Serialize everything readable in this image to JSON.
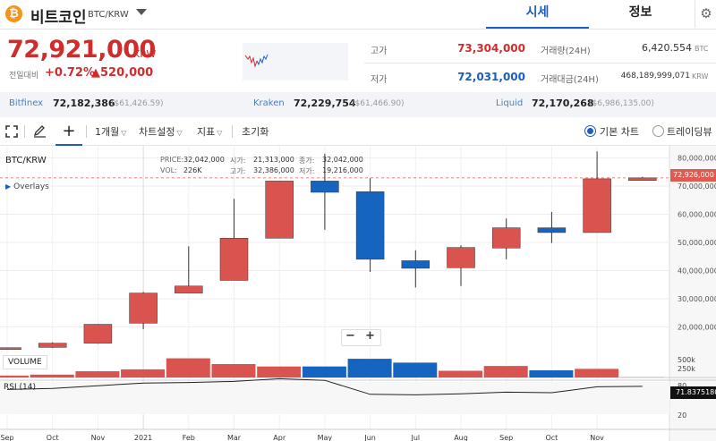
{
  "header": {
    "coin_icon_glyph": "₿",
    "coin_name": "비트코인",
    "coin_pair": "BTC/KRW",
    "tabs": [
      {
        "label": "시세",
        "active": true
      },
      {
        "label": "정보",
        "active": false
      }
    ],
    "gear_icon": "gear-icon"
  },
  "price": {
    "current": "72,921,000",
    "unit": "KRW",
    "change_label": "전일대비",
    "change_pct": "+0.72%",
    "change_amt": "▲520,000",
    "up_color": "#d12c2c",
    "down_color": "#1d5dbf"
  },
  "stats": {
    "high_label": "고가",
    "high_value": "73,304,000",
    "low_label": "저가",
    "low_value": "72,031,000",
    "volume_label": "거래량(24H)",
    "volume_value": "6,420.554",
    "volume_unit": "BTC",
    "amount_label": "거래대금(24H)",
    "amount_value": "468,189,999,071",
    "amount_unit": "KRW"
  },
  "exchanges": [
    {
      "name": "Bitfinex",
      "price": "72,182,386",
      "usd": "($61,426.59)"
    },
    {
      "name": "Kraken",
      "price": "72,229,754",
      "usd": "($61,466.90)"
    },
    {
      "name": "Liquid",
      "price": "72,170,268",
      "usd": "($6,986,135.00)"
    }
  ],
  "toolbar": {
    "fullscreen_icon": "fullscreen-icon",
    "draw_icon": "pencil-icon",
    "crosshair_icon": "crosshair-icon",
    "plus_glyph": "+",
    "interval": "1개월",
    "chart_settings": "차트설정",
    "indicators": "지표",
    "reset": "초기화",
    "basic_chart": "기본 차트",
    "trading_view": "트레이딩뷰"
  },
  "chart": {
    "symbol": "BTC/KRW",
    "overlays": "Overlays",
    "ohlc": {
      "price_label": "PRICE:",
      "price": "32,042,000",
      "open_label": "시가:",
      "open": "21,313,000",
      "close_label": "종가:",
      "close": "32,042,000",
      "vol_label": "VOL:",
      "vol": "226K",
      "high_label": "고가:",
      "high": "32,386,000",
      "low_label": "저가:",
      "low": "19,216,000"
    },
    "zoom_minus": "−",
    "zoom_plus": "+",
    "volume_label": "VOLUME",
    "rsi_label": "RSI (14)",
    "last_price_tag": "72,926,000",
    "rsi_value_tag": "71.83751808",
    "volume_ticks": [
      "500k",
      "250k"
    ],
    "rsi_ticks": [
      "80",
      "20"
    ]
  },
  "chart_data": {
    "type": "candlestick",
    "y_ticks": [
      80000000,
      70000000,
      60000000,
      50000000,
      40000000,
      30000000,
      20000000
    ],
    "y_tick_labels": [
      "80,000,000",
      "70,000,000",
      "60,000,000",
      "50,000,000",
      "40,000,000",
      "30,000,000",
      "20,000,000"
    ],
    "ylim": [
      9000000,
      84000000
    ],
    "x_labels": [
      "Sep",
      "Oct",
      "Nov",
      "2021",
      "Feb",
      "Mar",
      "Apr",
      "May",
      "Jun",
      "Jul",
      "Aug",
      "Sep",
      "Oct",
      "Nov"
    ],
    "candles": [
      {
        "o": 12000000,
        "h": 12500000,
        "l": 11600000,
        "c": 12600000,
        "v": 40000,
        "rsi": 66
      },
      {
        "o": 12700000,
        "h": 14500000,
        "l": 12500000,
        "c": 14200000,
        "v": 60000,
        "rsi": 68
      },
      {
        "o": 14200000,
        "h": 21000000,
        "l": 14000000,
        "c": 20900000,
        "v": 130000,
        "rsi": 73
      },
      {
        "o": 21300000,
        "h": 32400000,
        "l": 19200000,
        "c": 32000000,
        "v": 170000,
        "rsi": 78
      },
      {
        "o": 32000000,
        "h": 48600000,
        "l": 32000000,
        "c": 34500000,
        "v": 400000,
        "rsi": 79
      },
      {
        "o": 36500000,
        "h": 65500000,
        "l": 36500000,
        "c": 51500000,
        "v": 280000,
        "rsi": 81
      },
      {
        "o": 51500000,
        "h": 71500000,
        "l": 51500000,
        "c": 71800000,
        "v": 230000,
        "rsi": 86
      },
      {
        "o": 71800000,
        "h": 81500000,
        "l": 54500000,
        "c": 67800000,
        "v": 230000,
        "rsi": 83
      },
      {
        "o": 68000000,
        "h": 72800000,
        "l": 39500000,
        "c": 44000000,
        "v": 390000,
        "rsi": 57
      },
      {
        "o": 43500000,
        "h": 47200000,
        "l": 34000000,
        "c": 40800000,
        "v": 310000,
        "rsi": 56
      },
      {
        "o": 41000000,
        "h": 49000000,
        "l": 34500000,
        "c": 48200000,
        "v": 140000,
        "rsi": 58
      },
      {
        "o": 48000000,
        "h": 58500000,
        "l": 44000000,
        "c": 55200000,
        "v": 240000,
        "rsi": 61
      },
      {
        "o": 55200000,
        "h": 60800000,
        "l": 49800000,
        "c": 53500000,
        "v": 150000,
        "rsi": 60
      },
      {
        "o": 53500000,
        "h": 82300000,
        "l": 53500000,
        "c": 72600000,
        "v": 180000,
        "rsi": 71
      },
      {
        "o": 72000000,
        "h": 73300000,
        "l": 72000000,
        "c": 72926000,
        "v": 5000,
        "rsi": 71.8
      }
    ],
    "last_price": 72926000,
    "rsi_last": 71.83751808,
    "volume_ticks": [
      500000,
      250000
    ],
    "rsi_ticks": [
      80,
      20
    ],
    "up_color": "#d9534f",
    "down_color": "#1565c0",
    "grid": true
  }
}
